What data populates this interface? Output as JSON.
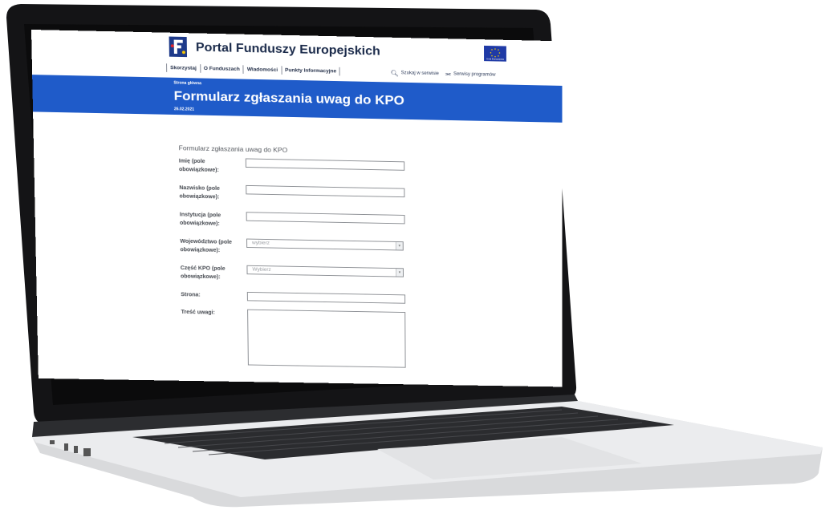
{
  "header": {
    "portal_title": "Portal Funduszy Europejskich",
    "nav": [
      "Skorzystaj",
      "O Funduszach",
      "Wiadomości",
      "Punkty Informacyjne"
    ],
    "search_label": "Szukaj w serwisie",
    "programs_label": "Serwisy programów",
    "eu_flag_caption": "Unia Europejska"
  },
  "banner": {
    "breadcrumb": "Strona główna",
    "title": "Formularz zgłaszania uwag do KPO",
    "date": "26.02.2021"
  },
  "form": {
    "heading": "Formularz zgłaszania uwag do KPO",
    "fields": [
      {
        "label": "Imię (pole obowiązkowe):",
        "type": "text",
        "value": ""
      },
      {
        "label": "Nazwisko (pole obowiązkowe):",
        "type": "text",
        "value": ""
      },
      {
        "label": "Instytucja (pole obowiązkowe):",
        "type": "text",
        "value": ""
      },
      {
        "label": "Województwo (pole obowiązkowe):",
        "type": "select",
        "value": "wybierz"
      },
      {
        "label": "Część KPO (pole obowiązkowe):",
        "type": "select",
        "value": "Wybierz"
      },
      {
        "label": "Strona:",
        "type": "text",
        "value": ""
      },
      {
        "label": "Treść uwagi:",
        "type": "textarea",
        "value": ""
      }
    ]
  },
  "colors": {
    "banner": "#1f5bc9",
    "title_text": "#1a2a4a"
  }
}
